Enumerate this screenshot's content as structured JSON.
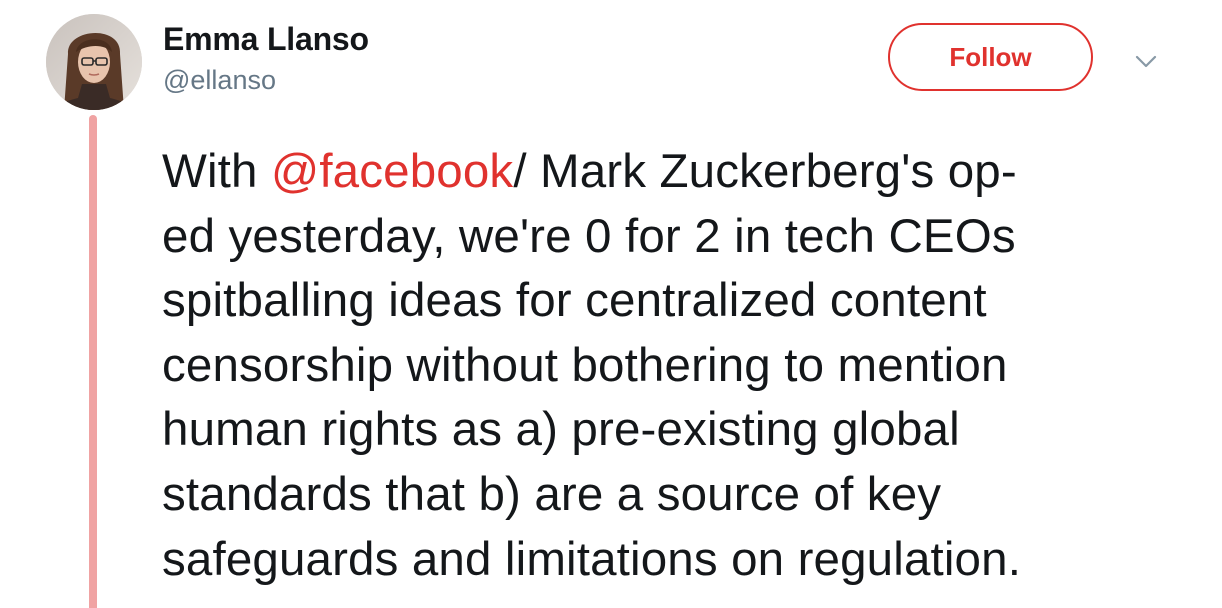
{
  "tweet": {
    "author": {
      "display_name": "Emma Llanso",
      "handle": "@ellanso"
    },
    "follow_label": "Follow",
    "text": {
      "line1_prefix": "With ",
      "mention": "@facebook",
      "line1_suffix": "/ Mark Zuckerberg's op-",
      "line2": "ed yesterday, we're 0 for 2 in tech CEOs",
      "line3": "spitballing ideas for centralized content",
      "line4": "censorship without bothering to mention",
      "line5": "human rights as a) pre-existing global",
      "line6": "standards that b) are a source of key",
      "line7": "safeguards and limitations on regulation."
    }
  },
  "colors": {
    "accent": "#e0322e",
    "thread_line": "#f0a3a3",
    "text": "#14171a",
    "secondary_text": "#657786"
  },
  "icons": {
    "caret": "chevron-down-icon",
    "avatar": "user-avatar"
  }
}
